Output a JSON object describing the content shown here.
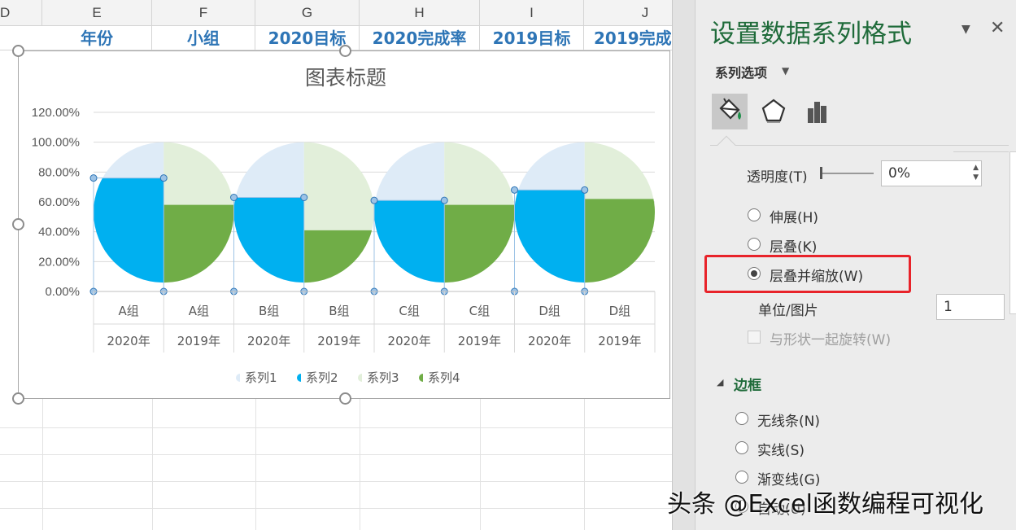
{
  "sheet": {
    "columns": [
      "D",
      "E",
      "F",
      "G",
      "H",
      "I",
      "J"
    ],
    "header_cells": [
      "年份",
      "小组",
      "2020目标",
      "2020完成率",
      "2019目标",
      "2019完成"
    ]
  },
  "chart_data": {
    "type": "bar",
    "title": "图表标题",
    "categories": [
      "A组",
      "A组",
      "B组",
      "B组",
      "C组",
      "C组",
      "D组",
      "D组"
    ],
    "category_groups": [
      "2020年",
      "2019年",
      "2020年",
      "2019年",
      "2020年",
      "2019年",
      "2020年",
      "2019年"
    ],
    "ylim": [
      0,
      1.2
    ],
    "y_ticks": [
      "0.00%",
      "20.00%",
      "40.00%",
      "60.00%",
      "80.00%",
      "100.00%",
      "120.00%"
    ],
    "grid": true,
    "legend_position": "bottom",
    "series": [
      {
        "name": "系列1",
        "values": [
          1,
          null,
          1,
          null,
          1,
          null,
          1,
          null
        ],
        "color": "#deebf7"
      },
      {
        "name": "系列2",
        "values": [
          0.76,
          null,
          0.63,
          null,
          0.61,
          null,
          0.68,
          null
        ],
        "color": "#00b0f0"
      },
      {
        "name": "系列3",
        "values": [
          null,
          1,
          null,
          1,
          null,
          1,
          null,
          1
        ],
        "color": "#e2efda"
      },
      {
        "name": "系列4",
        "values": [
          null,
          0.58,
          null,
          0.41,
          null,
          0.58,
          null,
          0.62
        ],
        "color": "#70ad47"
      }
    ]
  },
  "pane": {
    "title": "设置数据系列格式",
    "series_options": "系列选项",
    "transparency_label": "透明度(T)",
    "transparency_value": "0%",
    "options": [
      "伸展(H)",
      "层叠(K)",
      "层叠并缩放(W)"
    ],
    "selected_option": "层叠并缩放(W)",
    "unit_label": "单位/图片",
    "unit_value": "1",
    "rotate_label": "与形状一起旋转(W)",
    "border_section": "边框",
    "border_options": [
      "无线条(N)",
      "实线(S)",
      "渐变线(G)",
      "自动(U)"
    ]
  },
  "watermark": "头条 @Excel函数编程可视化"
}
